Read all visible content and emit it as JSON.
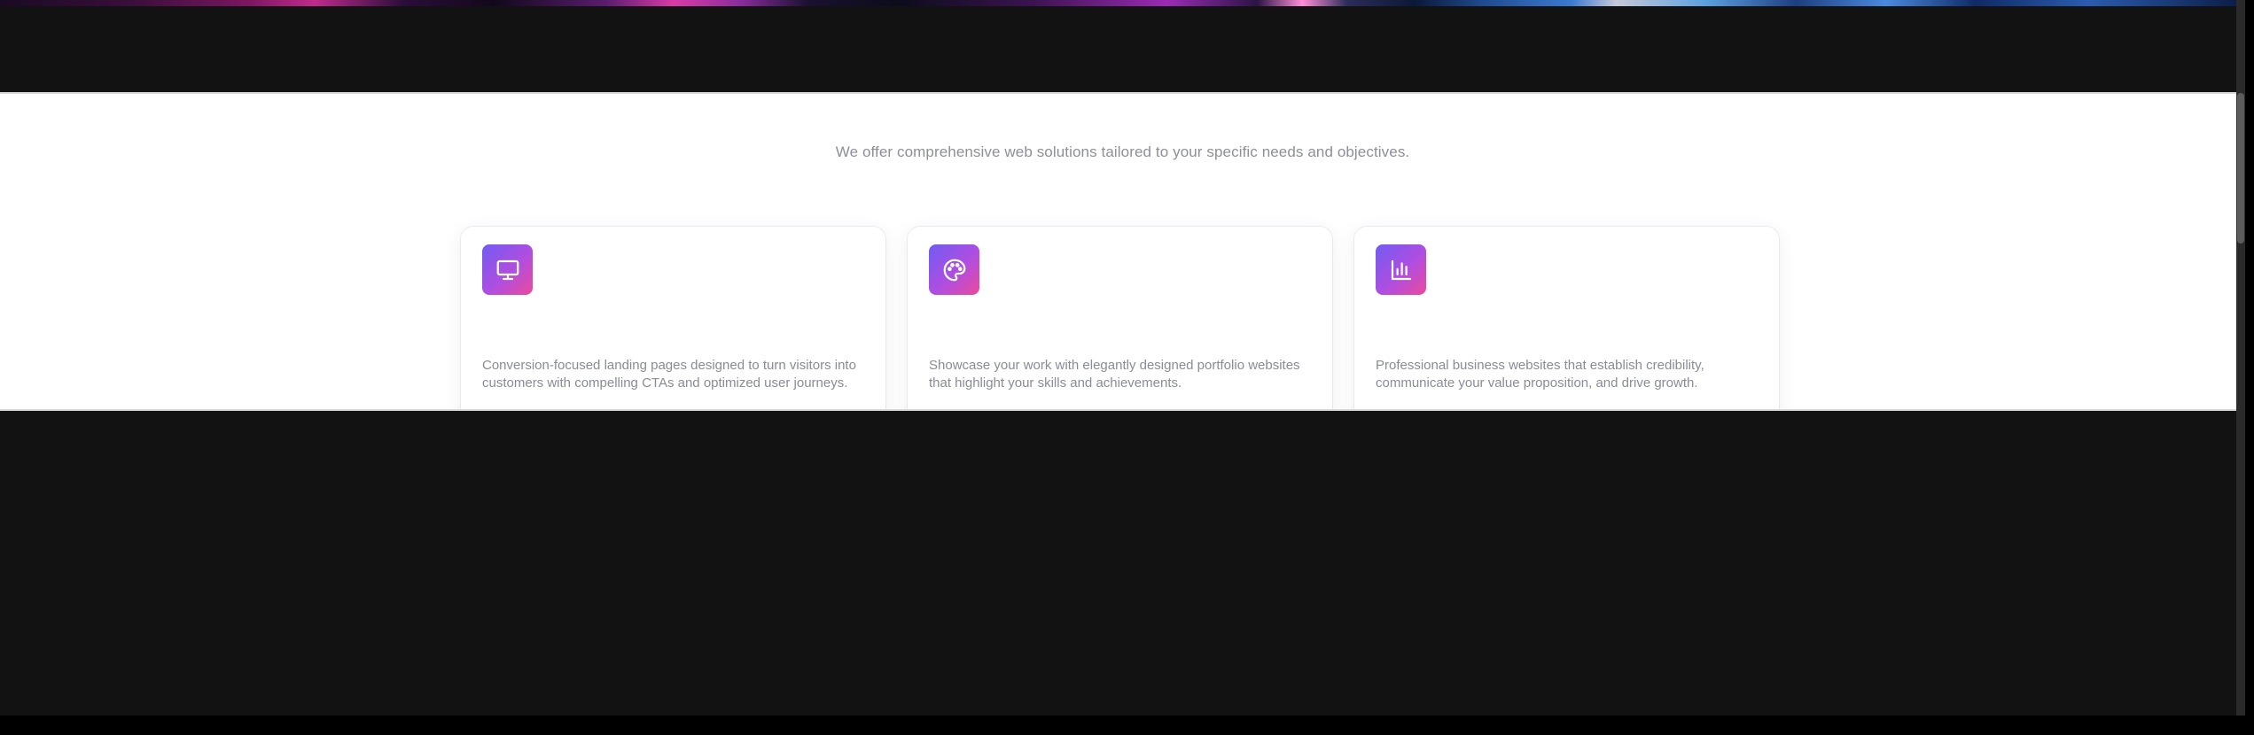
{
  "services": {
    "subtitle": "We offer comprehensive web solutions tailored to your specific needs and objectives.",
    "cards": [
      {
        "icon": "monitor-icon",
        "title": "",
        "description": "Conversion-focused landing pages designed to turn visitors into customers with compelling CTAs and optimized user journeys."
      },
      {
        "icon": "palette-icon",
        "title": "",
        "description": "Showcase your work with elegantly designed portfolio websites that highlight your skills and achievements."
      },
      {
        "icon": "bar-chart-icon",
        "title": "",
        "description": "Professional business websites that establish credibility, communicate your value proposition, and drive growth."
      }
    ]
  },
  "colors": {
    "page_background": "#121212",
    "section_background": "#ffffff",
    "icon_gradient_start": "#6f5cf2",
    "icon_gradient_end": "#ec4a9a",
    "muted_text": "#8e8f99"
  }
}
